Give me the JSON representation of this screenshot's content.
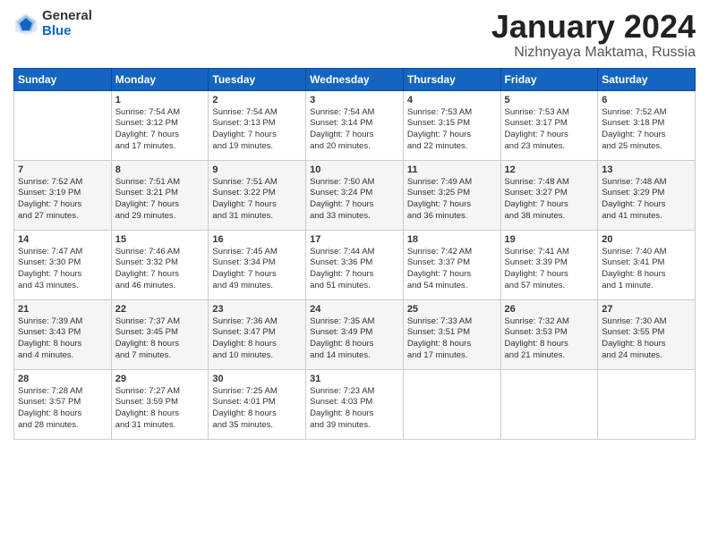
{
  "header": {
    "logo_general": "General",
    "logo_blue": "Blue",
    "month_title": "January 2024",
    "location": "Nizhnyaya Maktama, Russia"
  },
  "days_of_week": [
    "Sunday",
    "Monday",
    "Tuesday",
    "Wednesday",
    "Thursday",
    "Friday",
    "Saturday"
  ],
  "weeks": [
    [
      {
        "num": "",
        "info": ""
      },
      {
        "num": "1",
        "info": "Sunrise: 7:54 AM\nSunset: 3:12 PM\nDaylight: 7 hours\nand 17 minutes."
      },
      {
        "num": "2",
        "info": "Sunrise: 7:54 AM\nSunset: 3:13 PM\nDaylight: 7 hours\nand 19 minutes."
      },
      {
        "num": "3",
        "info": "Sunrise: 7:54 AM\nSunset: 3:14 PM\nDaylight: 7 hours\nand 20 minutes."
      },
      {
        "num": "4",
        "info": "Sunrise: 7:53 AM\nSunset: 3:15 PM\nDaylight: 7 hours\nand 22 minutes."
      },
      {
        "num": "5",
        "info": "Sunrise: 7:53 AM\nSunset: 3:17 PM\nDaylight: 7 hours\nand 23 minutes."
      },
      {
        "num": "6",
        "info": "Sunrise: 7:52 AM\nSunset: 3:18 PM\nDaylight: 7 hours\nand 25 minutes."
      }
    ],
    [
      {
        "num": "7",
        "info": "Sunrise: 7:52 AM\nSunset: 3:19 PM\nDaylight: 7 hours\nand 27 minutes."
      },
      {
        "num": "8",
        "info": "Sunrise: 7:51 AM\nSunset: 3:21 PM\nDaylight: 7 hours\nand 29 minutes."
      },
      {
        "num": "9",
        "info": "Sunrise: 7:51 AM\nSunset: 3:22 PM\nDaylight: 7 hours\nand 31 minutes."
      },
      {
        "num": "10",
        "info": "Sunrise: 7:50 AM\nSunset: 3:24 PM\nDaylight: 7 hours\nand 33 minutes."
      },
      {
        "num": "11",
        "info": "Sunrise: 7:49 AM\nSunset: 3:25 PM\nDaylight: 7 hours\nand 36 minutes."
      },
      {
        "num": "12",
        "info": "Sunrise: 7:48 AM\nSunset: 3:27 PM\nDaylight: 7 hours\nand 38 minutes."
      },
      {
        "num": "13",
        "info": "Sunrise: 7:48 AM\nSunset: 3:29 PM\nDaylight: 7 hours\nand 41 minutes."
      }
    ],
    [
      {
        "num": "14",
        "info": "Sunrise: 7:47 AM\nSunset: 3:30 PM\nDaylight: 7 hours\nand 43 minutes."
      },
      {
        "num": "15",
        "info": "Sunrise: 7:46 AM\nSunset: 3:32 PM\nDaylight: 7 hours\nand 46 minutes."
      },
      {
        "num": "16",
        "info": "Sunrise: 7:45 AM\nSunset: 3:34 PM\nDaylight: 7 hours\nand 49 minutes."
      },
      {
        "num": "17",
        "info": "Sunrise: 7:44 AM\nSunset: 3:36 PM\nDaylight: 7 hours\nand 51 minutes."
      },
      {
        "num": "18",
        "info": "Sunrise: 7:42 AM\nSunset: 3:37 PM\nDaylight: 7 hours\nand 54 minutes."
      },
      {
        "num": "19",
        "info": "Sunrise: 7:41 AM\nSunset: 3:39 PM\nDaylight: 7 hours\nand 57 minutes."
      },
      {
        "num": "20",
        "info": "Sunrise: 7:40 AM\nSunset: 3:41 PM\nDaylight: 8 hours\nand 1 minute."
      }
    ],
    [
      {
        "num": "21",
        "info": "Sunrise: 7:39 AM\nSunset: 3:43 PM\nDaylight: 8 hours\nand 4 minutes."
      },
      {
        "num": "22",
        "info": "Sunrise: 7:37 AM\nSunset: 3:45 PM\nDaylight: 8 hours\nand 7 minutes."
      },
      {
        "num": "23",
        "info": "Sunrise: 7:36 AM\nSunset: 3:47 PM\nDaylight: 8 hours\nand 10 minutes."
      },
      {
        "num": "24",
        "info": "Sunrise: 7:35 AM\nSunset: 3:49 PM\nDaylight: 8 hours\nand 14 minutes."
      },
      {
        "num": "25",
        "info": "Sunrise: 7:33 AM\nSunset: 3:51 PM\nDaylight: 8 hours\nand 17 minutes."
      },
      {
        "num": "26",
        "info": "Sunrise: 7:32 AM\nSunset: 3:53 PM\nDaylight: 8 hours\nand 21 minutes."
      },
      {
        "num": "27",
        "info": "Sunrise: 7:30 AM\nSunset: 3:55 PM\nDaylight: 8 hours\nand 24 minutes."
      }
    ],
    [
      {
        "num": "28",
        "info": "Sunrise: 7:28 AM\nSunset: 3:57 PM\nDaylight: 8 hours\nand 28 minutes."
      },
      {
        "num": "29",
        "info": "Sunrise: 7:27 AM\nSunset: 3:59 PM\nDaylight: 8 hours\nand 31 minutes."
      },
      {
        "num": "30",
        "info": "Sunrise: 7:25 AM\nSunset: 4:01 PM\nDaylight: 8 hours\nand 35 minutes."
      },
      {
        "num": "31",
        "info": "Sunrise: 7:23 AM\nSunset: 4:03 PM\nDaylight: 8 hours\nand 39 minutes."
      },
      {
        "num": "",
        "info": ""
      },
      {
        "num": "",
        "info": ""
      },
      {
        "num": "",
        "info": ""
      }
    ]
  ]
}
